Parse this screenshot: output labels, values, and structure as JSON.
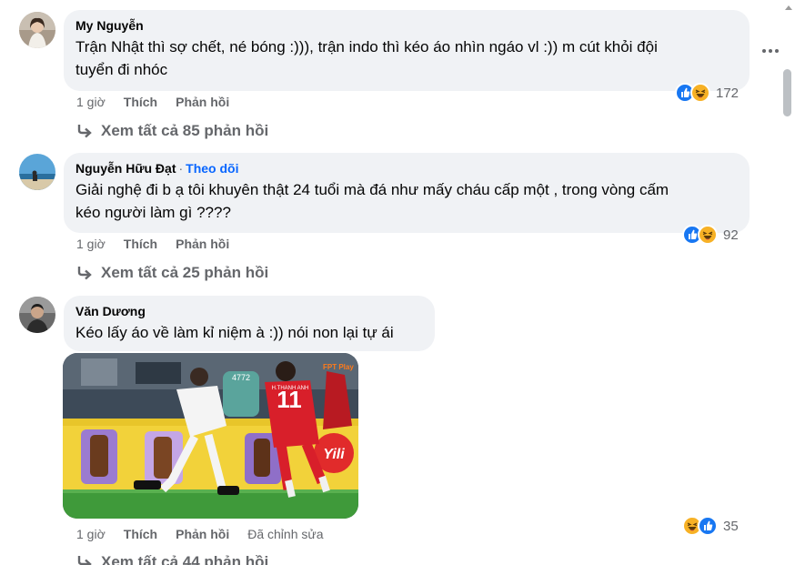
{
  "comments": [
    {
      "author": "My Nguyễn",
      "text": "Trận Nhật thì sợ chết, né bóng :))), trận indo thì kéo áo nhìn ngáo vl :)) m cút khỏi đội tuyển đi nhóc",
      "line1": "Trận Nhật thì sợ chết, né bóng :))), trận indo thì kéo áo nhìn ngáo vl :)) m cút khỏi đội",
      "line2": "tuyển đi nhóc",
      "time": "1 giờ",
      "like": "Thích",
      "reply": "Phản hồi",
      "reaction_count": "172",
      "replies_text": "Xem tất cả 85 phản hồi",
      "reactions": [
        "like-icon",
        "haha-icon"
      ]
    },
    {
      "author": "Nguyễn Hữu Đạt",
      "separator": "·",
      "follow": "Theo dõi",
      "line1": "Giải nghệ đi b ạ tôi khuyên thật 24 tuổi mà đá như mấy cháu cấp một , trong vòng cấm",
      "line2": "kéo người làm gì ????",
      "time": "1 giờ",
      "like": "Thích",
      "reply": "Phản hồi",
      "reaction_count": "92",
      "replies_text": "Xem tất cả 25 phản hồi",
      "reactions": [
        "like-icon",
        "haha-icon"
      ]
    },
    {
      "author": "Văn Dương",
      "line1": "Kéo lấy áo về làm kỉ niệm à :)) nói non lại tự ái",
      "time": "1 giờ",
      "like": "Thích",
      "reply": "Phản hồi",
      "edited": "Đã chỉnh sửa",
      "reaction_count": "35",
      "replies_text": "Xem tất cả 44 phản hồi",
      "reactions": [
        "haha-icon",
        "like-icon"
      ],
      "image": {
        "jersey_number": "11",
        "jersey_name": "H.THANH ANH",
        "board_number": "4772",
        "sponsor": "Yili",
        "broadcaster": "FPT Play"
      }
    }
  ],
  "colors": {
    "bubble": "#f0f2f5",
    "meta_text": "#65676b",
    "follow": "#0866ff",
    "like": "#1877f2",
    "haha": "#f7b125"
  }
}
